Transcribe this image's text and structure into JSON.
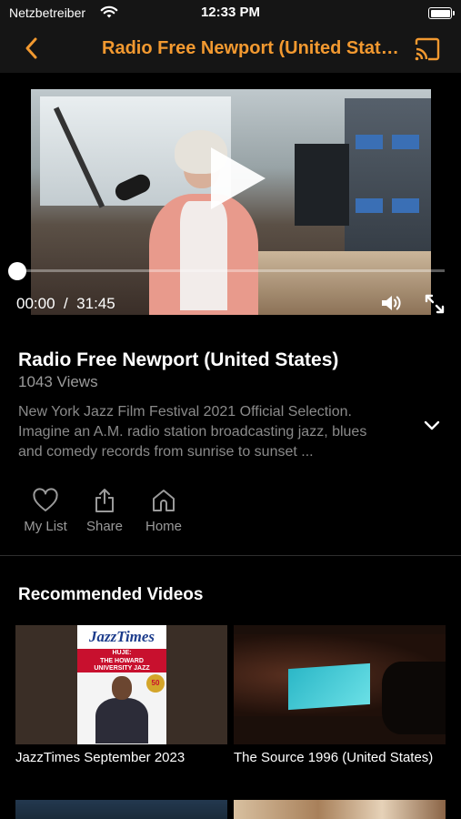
{
  "status_bar": {
    "carrier": "Netzbetreiber",
    "time": "12:33 PM"
  },
  "nav": {
    "title": "Radio Free Newport (United States)"
  },
  "player": {
    "current_time": "00:00",
    "duration": "31:45",
    "time_display": "00:00  /  31:45",
    "progress": 0
  },
  "video": {
    "title": "Radio Free Newport (United States)",
    "views": "1043 Views",
    "description_lines": [
      "New York Jazz Film Festival 2021 Official Selection.",
      "Imagine an A.M. radio station broadcasting jazz, blues",
      "and comedy records from sunrise to sunset ..."
    ]
  },
  "actions": [
    {
      "label": "My List",
      "icon": "heart-icon"
    },
    {
      "label": "Share",
      "icon": "share-icon"
    },
    {
      "label": "Home",
      "icon": "home-icon"
    }
  ],
  "recommended": {
    "title": "Recommended Videos",
    "items": [
      {
        "title": "JazzTimes September 2023",
        "thumb_text": {
          "masthead": "JazzTimes",
          "band_lines": [
            "HUJE:",
            "THE HOWARD",
            "UNIVERSITY JAZZ",
            "ENSEMBLE"
          ],
          "badge": "50"
        }
      },
      {
        "title": "The Source 1996 (United States)"
      }
    ]
  },
  "colors": {
    "accent": "#f29930",
    "background": "#000000",
    "bar": "#151515",
    "muted_text": "#9a9a9a"
  }
}
